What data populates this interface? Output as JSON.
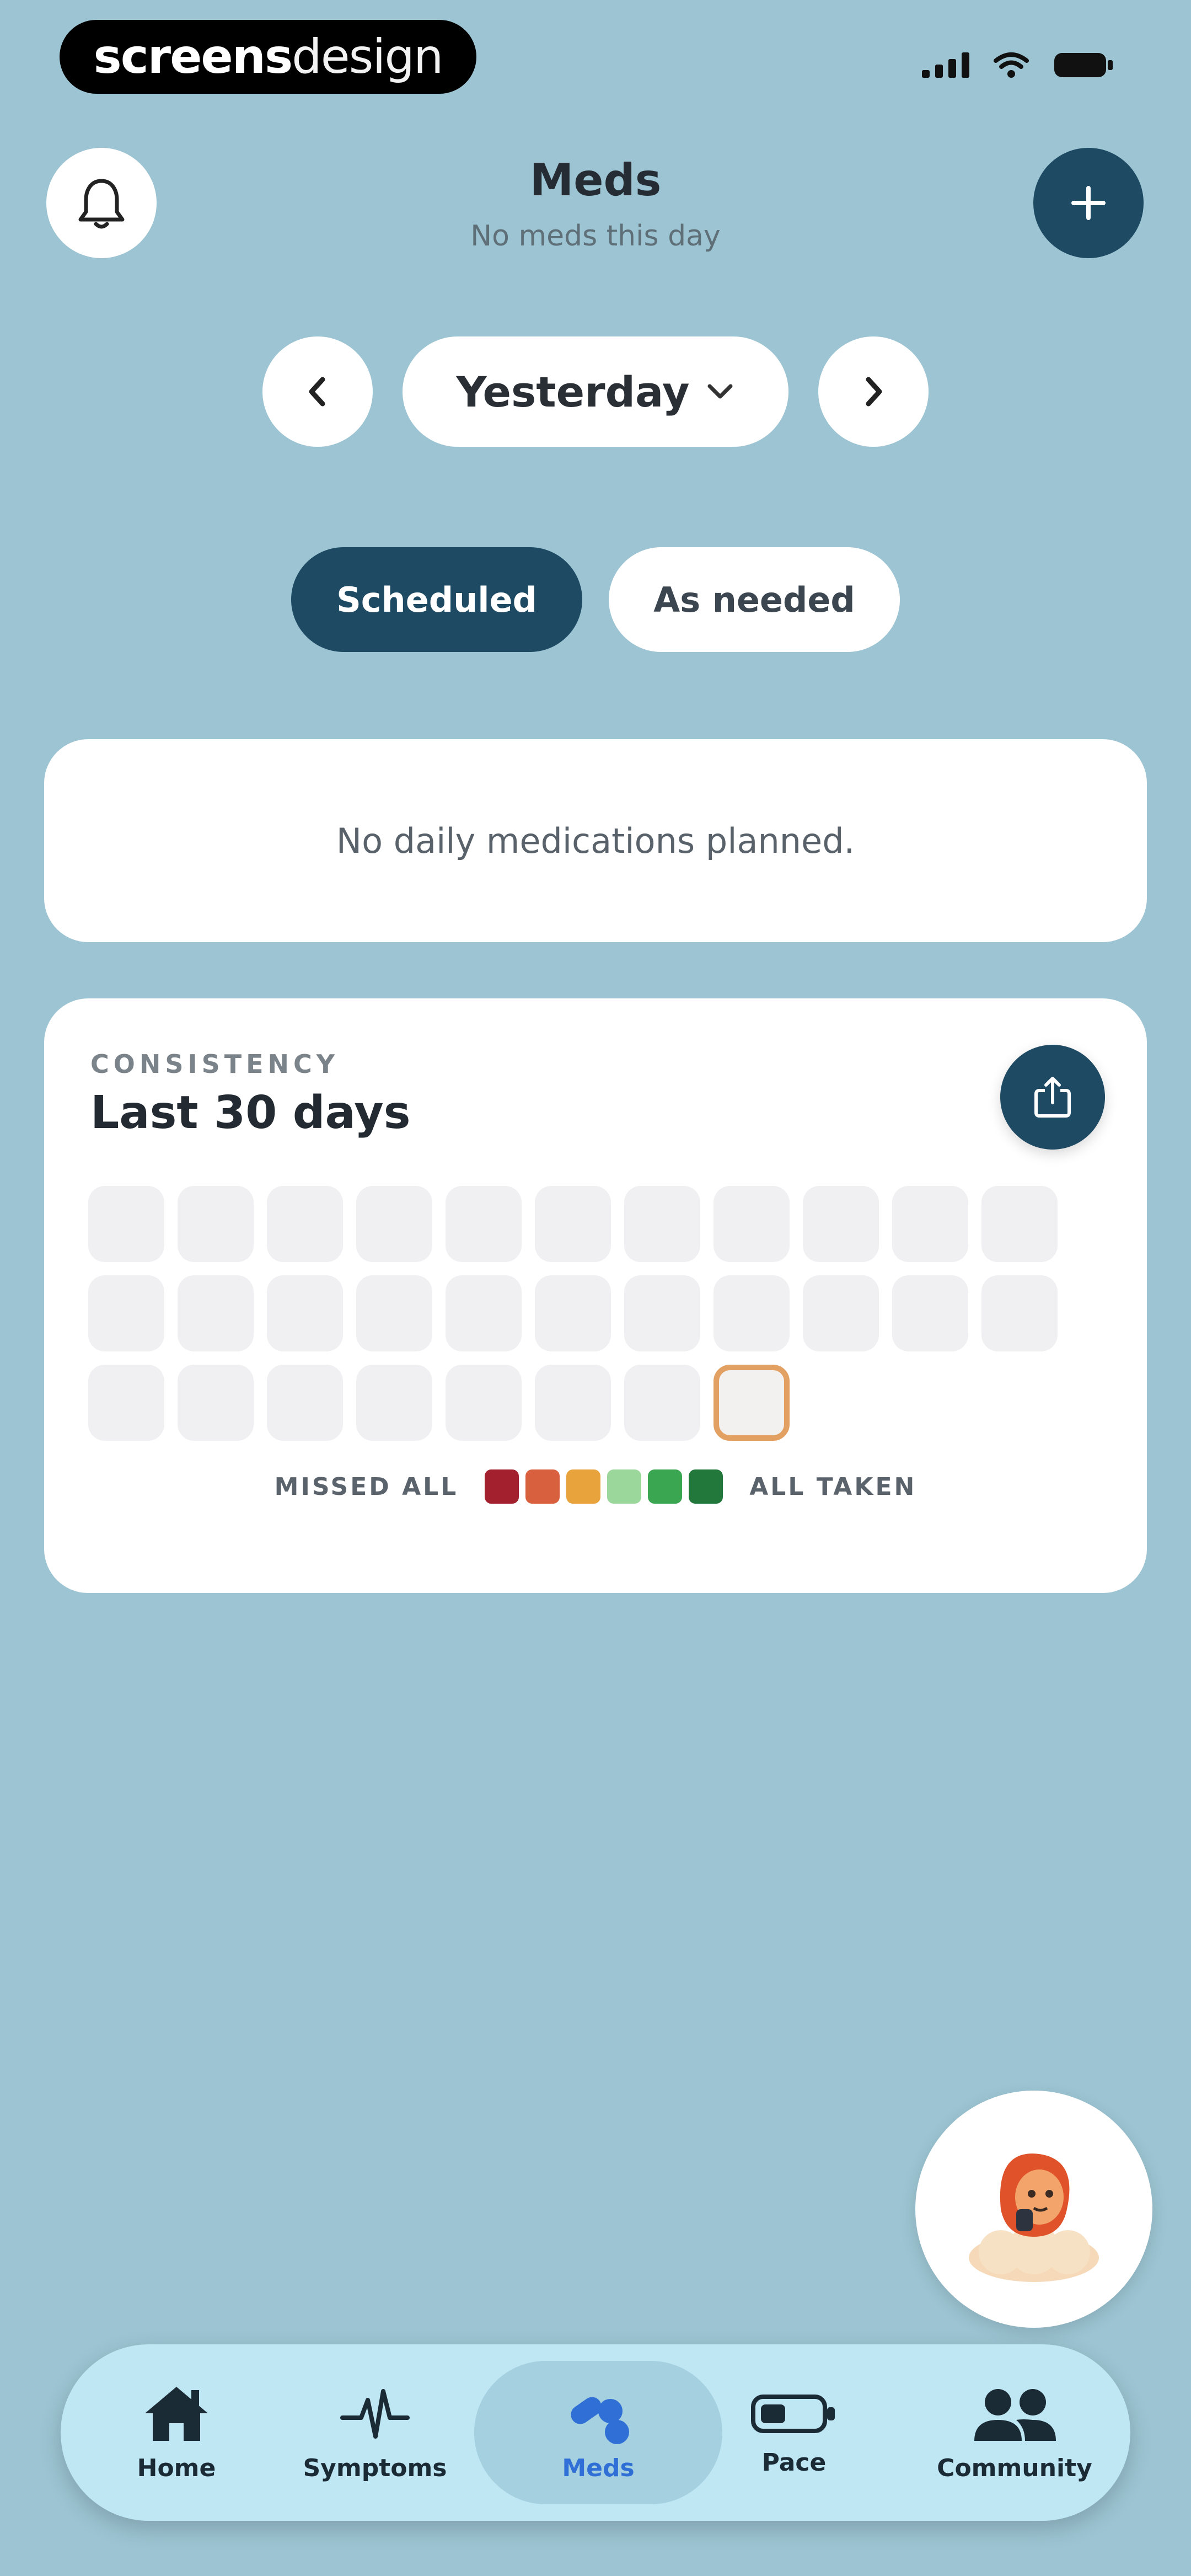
{
  "status": {
    "brand_bold": "screens",
    "brand_light": "design"
  },
  "header": {
    "title": "Meds",
    "subtitle": "No meds this day"
  },
  "date_nav": {
    "label": "Yesterday"
  },
  "tabs": [
    {
      "label": "Scheduled",
      "active": true
    },
    {
      "label": "As needed",
      "active": false
    }
  ],
  "empty_state": {
    "text": "No daily medications planned."
  },
  "consistency": {
    "eyebrow": "CONSISTENCY",
    "title": "Last 30 days",
    "legend_left": "MISSED ALL",
    "legend_right": "ALL TAKEN",
    "swatch_colors": [
      "#a3202f",
      "#d9603f",
      "#e9a33c",
      "#9bd79a",
      "#3aa651",
      "#22783a"
    ],
    "days_count": 30
  },
  "bottom_nav": [
    {
      "label": "Home",
      "icon": "home-icon",
      "active": false
    },
    {
      "label": "Symptoms",
      "icon": "heartbeat-icon",
      "active": false
    },
    {
      "label": "Meds",
      "icon": "pills-icon",
      "active": true
    },
    {
      "label": "Pace",
      "icon": "battery-icon",
      "active": false
    },
    {
      "label": "Community",
      "icon": "people-icon",
      "active": false
    }
  ],
  "colors": {
    "background": "#9cc4d2",
    "primary": "#1f4a63",
    "active_nav": "#2f6fd6",
    "today_outline": "#e3a063"
  }
}
